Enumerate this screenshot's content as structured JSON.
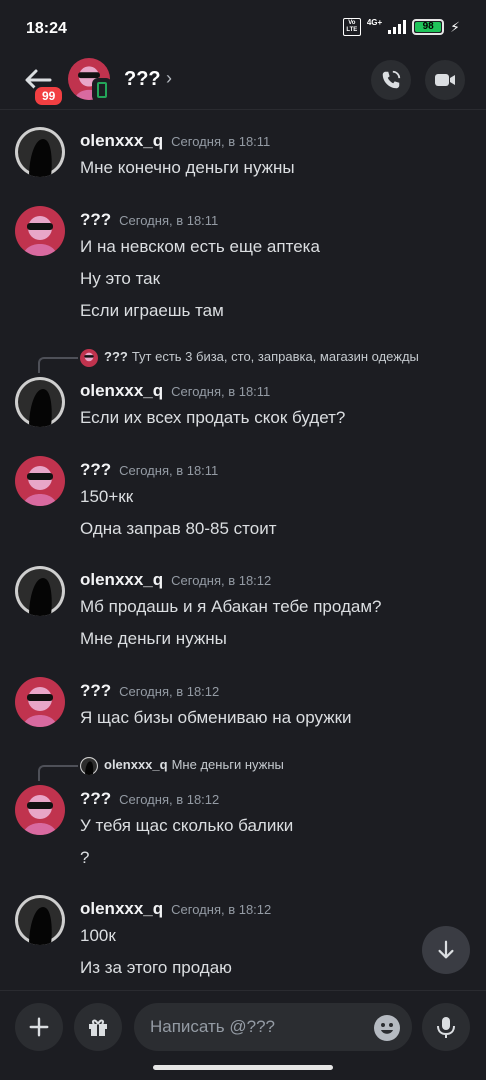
{
  "status_bar": {
    "time": "18:24",
    "volte": "Vo LTE",
    "network": "4G+",
    "battery": "98"
  },
  "header": {
    "unread_count": "99",
    "title": "???",
    "chevron": "›"
  },
  "messages": [
    {
      "author": "olenxxx_q",
      "timestamp": "Сегодня, в 18:11",
      "lines": [
        "Мне конечно деньги нужны"
      ],
      "avatar": "dark"
    },
    {
      "author": "???",
      "timestamp": "Сегодня, в 18:11",
      "lines": [
        "И на невском есть еще аптека",
        "Ну это так",
        "Если играешь там"
      ],
      "avatar": "pink"
    },
    {
      "reply": {
        "author": "???",
        "text": "Тут есть 3 биза, сто, заправка, магазин одежды",
        "avatar": "pink"
      },
      "author": "olenxxx_q",
      "timestamp": "Сегодня, в 18:11",
      "lines": [
        "Если их всех продать скок будет?"
      ],
      "avatar": "dark"
    },
    {
      "author": "???",
      "timestamp": "Сегодня, в 18:11",
      "lines": [
        "150+кк",
        "Одна заправ 80-85 стоит"
      ],
      "avatar": "pink"
    },
    {
      "author": "olenxxx_q",
      "timestamp": "Сегодня, в 18:12",
      "lines": [
        "Мб продашь и я Абакан тебе продам?",
        "Мне деньги нужны"
      ],
      "avatar": "dark"
    },
    {
      "author": "???",
      "timestamp": "Сегодня, в 18:12",
      "lines": [
        "Я щас бизы обмениваю на оружки"
      ],
      "avatar": "pink"
    },
    {
      "reply": {
        "author": "olenxxx_q",
        "text": "Мне деньги нужны",
        "avatar": "dark"
      },
      "author": "???",
      "timestamp": "Сегодня, в 18:12",
      "lines": [
        "У тебя щас сколько балики",
        "?"
      ],
      "avatar": "pink"
    },
    {
      "author": "olenxxx_q",
      "timestamp": "Сегодня, в 18:12",
      "lines": [
        "100к",
        "Из за этого продаю"
      ],
      "avatar": "dark"
    }
  ],
  "composer": {
    "placeholder": "Написать @???"
  },
  "colors": {
    "background": "#1c1d22",
    "badge": "#f23f42",
    "online": "#23a559",
    "battery": "#1fc45a"
  }
}
